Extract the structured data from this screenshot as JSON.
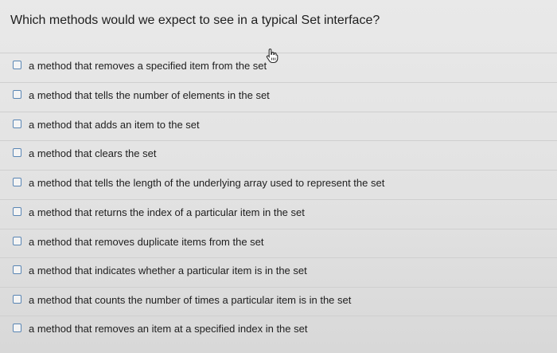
{
  "question": "Which methods would we expect to see in a typical Set interface?",
  "options": [
    {
      "label": "a method that removes a specified item from the set"
    },
    {
      "label": "a method that tells the number of elements in the set"
    },
    {
      "label": "a method that adds an item to the set"
    },
    {
      "label": "a method that clears the set"
    },
    {
      "label": "a method that tells the length of the underlying array used to represent the set"
    },
    {
      "label": "a method that returns the index of a particular item in the set"
    },
    {
      "label": "a method that removes duplicate items from the set"
    },
    {
      "label": "a method that indicates whether a particular item is in the set"
    },
    {
      "label": "a method that counts the number of times a particular item is in the set"
    },
    {
      "label": "a method that removes an item at a specified index in the set"
    }
  ],
  "cursor_icon": "hand-pointer-icon"
}
